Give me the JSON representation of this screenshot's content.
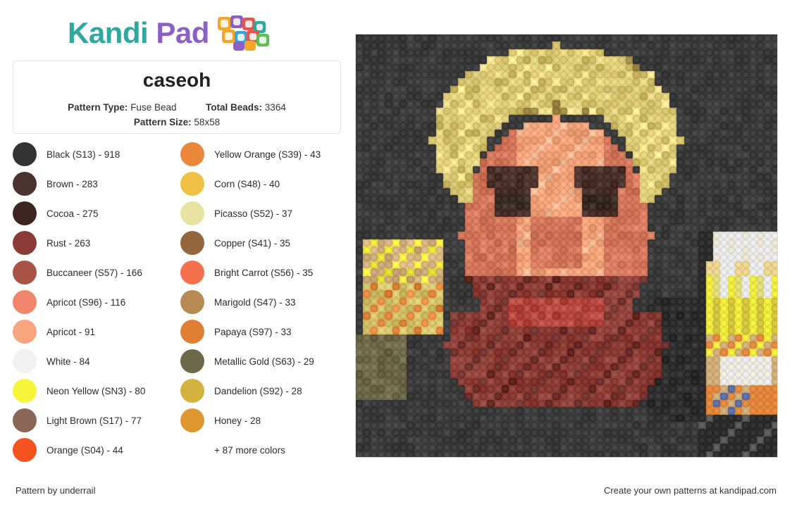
{
  "brand": {
    "name_part1": "Kandi",
    "name_part2": "Pad",
    "logo_icon": "kandi-beads-icon",
    "color_teal": "#2fa8a0",
    "color_purple": "#8b5fc4"
  },
  "pattern": {
    "title": "caseoh",
    "type_label": "Pattern Type:",
    "type_value": "Fuse Bead",
    "total_label": "Total Beads:",
    "total_value": "3364",
    "size_label": "Pattern Size:",
    "size_value": "58x58"
  },
  "colors": [
    {
      "name": "Black (S13) - 918",
      "hex": "#333333"
    },
    {
      "name": "Brown - 283",
      "hex": "#4b3430"
    },
    {
      "name": "Cocoa - 275",
      "hex": "#3d2522"
    },
    {
      "name": "Rust - 263",
      "hex": "#8c3a38"
    },
    {
      "name": "Buccaneer (S57) - 166",
      "hex": "#a85344"
    },
    {
      "name": "Apricot (S96) - 116",
      "hex": "#f2866c"
    },
    {
      "name": "Apricot - 91",
      "hex": "#f8a57f"
    },
    {
      "name": "White - 84",
      "hex": "#f1f1f1"
    },
    {
      "name": "Neon Yellow (SN3) - 80",
      "hex": "#f7f53a"
    },
    {
      "name": "Light Brown (S17) - 77",
      "hex": "#8a6657"
    },
    {
      "name": "Orange (S04) - 44",
      "hex": "#f4521f"
    },
    {
      "name": "Yellow Orange (S39) - 43",
      "hex": "#e9883b"
    },
    {
      "name": "Corn (S48) - 40",
      "hex": "#eec044"
    },
    {
      "name": "Picasso (S52) - 37",
      "hex": "#e8e3a2"
    },
    {
      "name": "Copper (S41) - 35",
      "hex": "#95663b"
    },
    {
      "name": "Bright Carrot (S56) - 35",
      "hex": "#f5704c"
    },
    {
      "name": "Marigold (S47) - 33",
      "hex": "#b68a52"
    },
    {
      "name": "Papaya (S97) - 33",
      "hex": "#e07e34"
    },
    {
      "name": "Metallic Gold (S63) - 29",
      "hex": "#6d6848"
    },
    {
      "name": "Dandelion (S92) - 28",
      "hex": "#d4b23e"
    },
    {
      "name": "Honey - 28",
      "hex": "#e0972f"
    }
  ],
  "more_colors_label": "+ 87 more colors",
  "footer": {
    "left": "Pattern by underrail",
    "right": "Create your own patterns at kandipad.com"
  },
  "preview": {
    "alt": "caseoh fuse bead pattern preview",
    "grid_size": 58,
    "background": "#3a3a3a"
  }
}
